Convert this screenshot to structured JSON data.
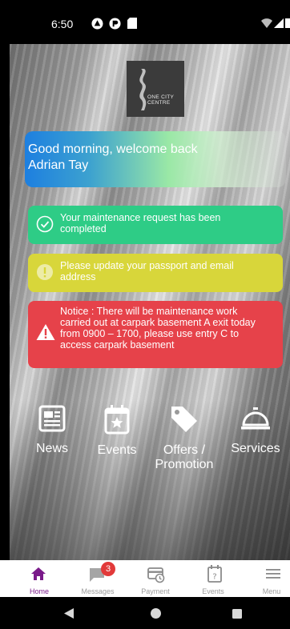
{
  "status_bar": {
    "time": "6:50"
  },
  "logo": {
    "line1": "ONE CITY",
    "line2": "CENTRE"
  },
  "welcome": {
    "greeting": "Good morning, welcome back",
    "name": "Adrian Tay"
  },
  "notifications": [
    {
      "type": "success",
      "text": "Your maintenance request has been completed",
      "color": "#2ecc86"
    },
    {
      "type": "warning",
      "text": "Please update your passport and email address",
      "color": "#d8d63a"
    },
    {
      "type": "alert",
      "text": "Notice : There will be maintenance work carried  out at carpark basement A exit today from 0900 – 1700, please use entry C to access carpark basement",
      "color": "#e6424a"
    }
  ],
  "shortcuts": [
    {
      "label": "News",
      "icon": "newspaper-icon"
    },
    {
      "label": "Events",
      "icon": "calendar-star-icon"
    },
    {
      "label": "Offers / Promotion",
      "icon": "tag-icon"
    },
    {
      "label": "Services",
      "icon": "service-bell-icon"
    }
  ],
  "tabbar": {
    "items": [
      {
        "label": "Home",
        "icon": "home-icon",
        "active": true
      },
      {
        "label": "Messages",
        "icon": "message-icon",
        "badge": "3"
      },
      {
        "label": "Payment",
        "icon": "payment-icon"
      },
      {
        "label": "Events",
        "icon": "calendar-question-icon"
      },
      {
        "label": "Menu",
        "icon": "hamburger-icon"
      }
    ],
    "accent": "#7a1a8a"
  }
}
